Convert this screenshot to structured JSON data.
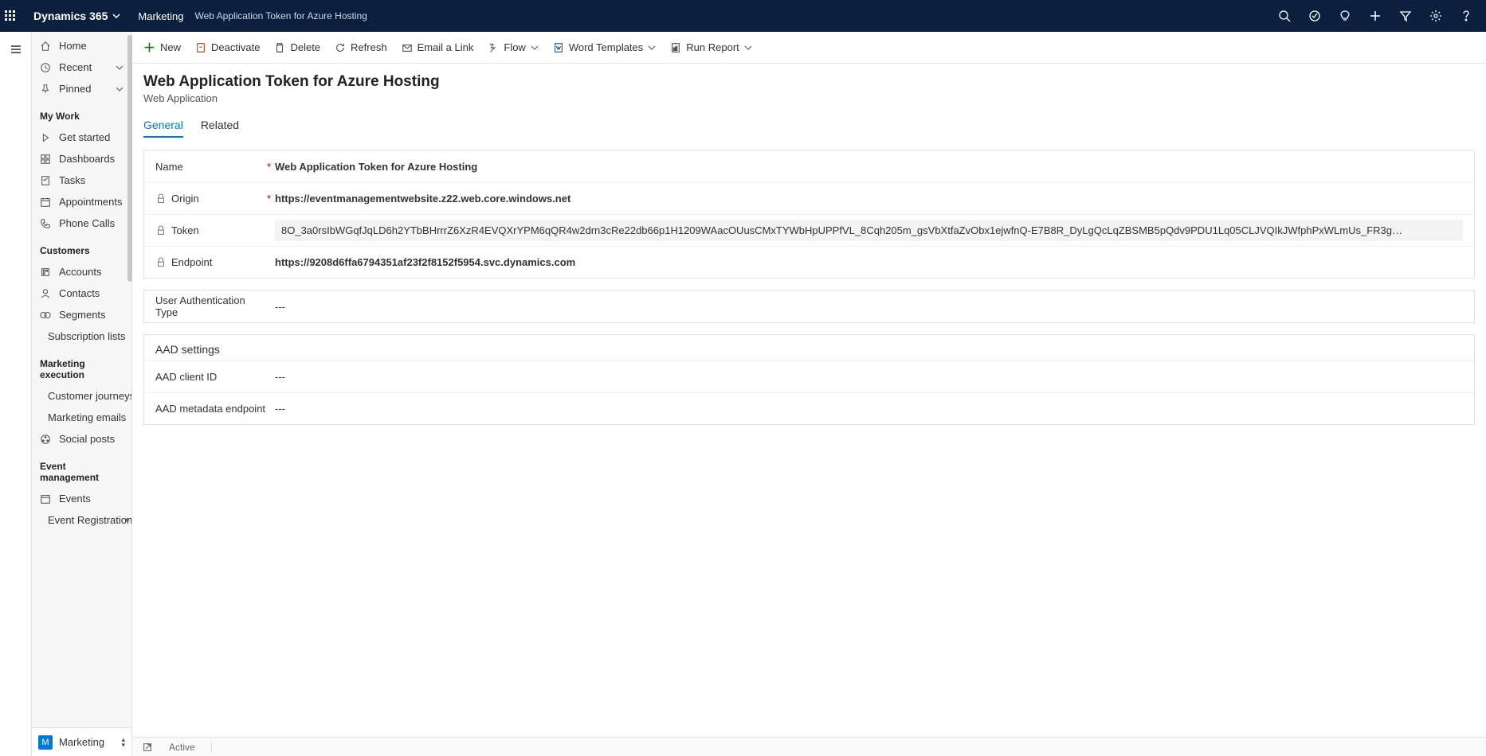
{
  "topbar": {
    "brand": "Dynamics 365",
    "area": "Marketing",
    "breadcrumb": "Web Application Token for Azure Hosting"
  },
  "sidebar": {
    "top": [
      {
        "icon": "home",
        "label": "Home"
      },
      {
        "icon": "clock",
        "label": "Recent",
        "chevron": true
      },
      {
        "icon": "pin",
        "label": "Pinned",
        "chevron": true
      }
    ],
    "groups": [
      {
        "title": "My Work",
        "items": [
          {
            "icon": "play",
            "label": "Get started"
          },
          {
            "icon": "dashboard",
            "label": "Dashboards"
          },
          {
            "icon": "task",
            "label": "Tasks"
          },
          {
            "icon": "calendar",
            "label": "Appointments"
          },
          {
            "icon": "phone",
            "label": "Phone Calls"
          }
        ]
      },
      {
        "title": "Customers",
        "items": [
          {
            "icon": "account",
            "label": "Accounts"
          },
          {
            "icon": "contact",
            "label": "Contacts"
          },
          {
            "icon": "segment",
            "label": "Segments"
          },
          {
            "icon": "list",
            "label": "Subscription lists"
          }
        ]
      },
      {
        "title": "Marketing execution",
        "items": [
          {
            "icon": "journey",
            "label": "Customer journeys"
          },
          {
            "icon": "email",
            "label": "Marketing emails"
          },
          {
            "icon": "social",
            "label": "Social posts"
          }
        ]
      },
      {
        "title": "Event management",
        "items": [
          {
            "icon": "event",
            "label": "Events"
          },
          {
            "icon": "eventreg",
            "label": "Event Registrations",
            "sub": true
          }
        ]
      }
    ],
    "footer": {
      "badge": "M",
      "label": "Marketing"
    }
  },
  "commands": {
    "new": "New",
    "deactivate": "Deactivate",
    "delete": "Delete",
    "refresh": "Refresh",
    "emaillink": "Email a Link",
    "flow": "Flow",
    "wordtpl": "Word Templates",
    "runreport": "Run Report"
  },
  "page": {
    "title": "Web Application Token for Azure Hosting",
    "subtitle": "Web Application",
    "tabs": {
      "general": "General",
      "related": "Related"
    }
  },
  "fields": {
    "name": {
      "label": "Name",
      "value": "Web Application Token for Azure Hosting"
    },
    "origin": {
      "label": "Origin",
      "value": "https://eventmanagementwebsite.z22.web.core.windows.net"
    },
    "token": {
      "label": "Token",
      "value": "8O_3a0rsIbWGqfJqLD6h2YTbBHrrrZ6XzR4EVQXrYPM6qQR4w2drn3cRe22db66p1H1209WAacOUusCMxTYWbHpUPPfVL_8Cqh205m_gsVbXtfaZvObx1ejwfnQ-E7B8R_DyLgQcLqZBSMB5pQdv9PDU1Lq05CLJVQIkJWfphPxWLmUs_FR3g…"
    },
    "endpoint": {
      "label": "Endpoint",
      "value": "https://9208d6ffa6794351af23f2f8152f5954.svc.dynamics.com"
    },
    "authtype": {
      "label": "User Authentication Type",
      "value": "---"
    },
    "aad_title": "AAD settings",
    "aadclient": {
      "label": "AAD client ID",
      "value": "---"
    },
    "aadmeta": {
      "label": "AAD metadata endpoint",
      "value": "---"
    }
  },
  "status": {
    "label": "Active"
  }
}
